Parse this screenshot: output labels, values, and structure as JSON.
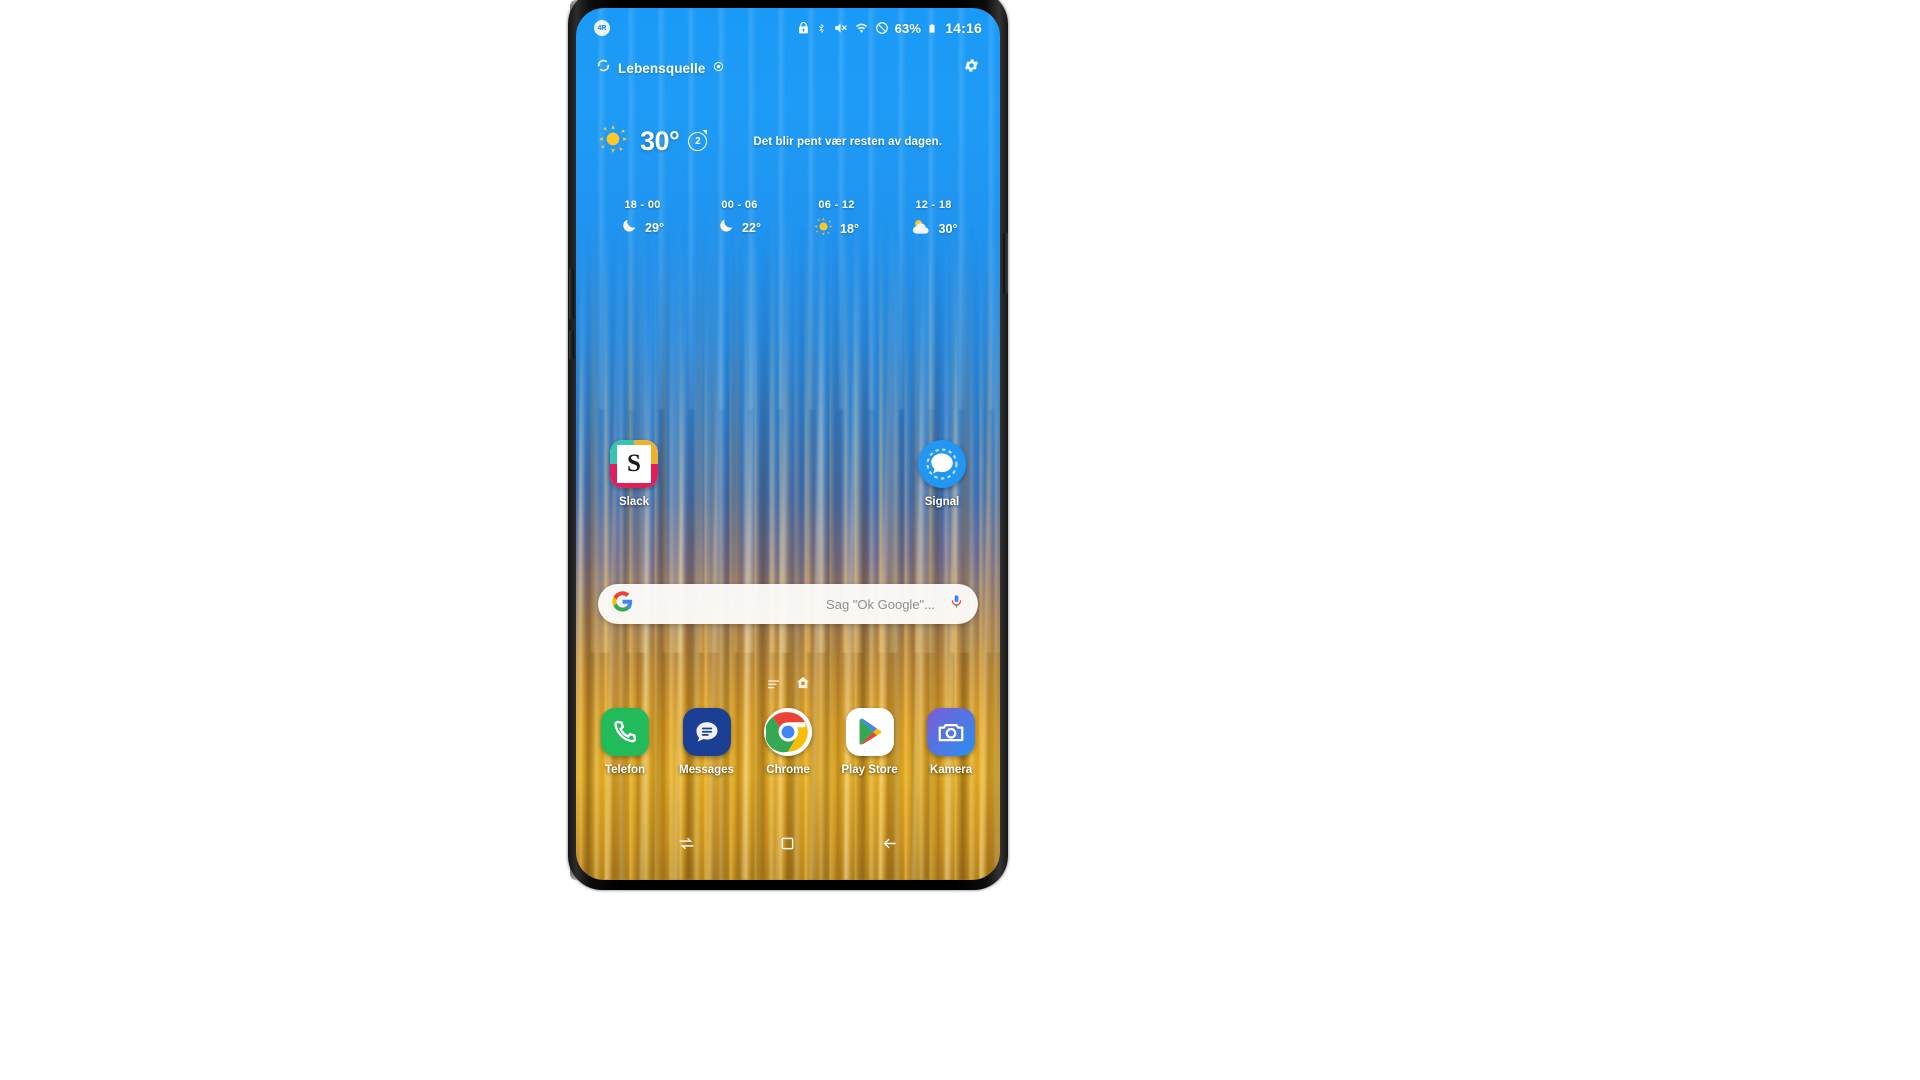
{
  "device": {
    "name": "samsung-galaxy-note-9",
    "screen_label": "home-screen"
  },
  "status_bar": {
    "left_badge": "4R",
    "icons": [
      "secure-lock-icon",
      "bluetooth-icon",
      "volume-mute-icon",
      "wifi-icon",
      "do-not-disturb-icon",
      "battery-icon"
    ],
    "battery_percent": "63%",
    "time": "14:16"
  },
  "weather_widget": {
    "refresh_icon": "refresh-icon",
    "source": "Lebensquelle",
    "location_icon": "location-pin-icon",
    "settings_icon": "gear-icon",
    "condition_icon": "sun-icon",
    "temperature": "30°",
    "refresh_count": "2",
    "description": "Det blir pent vær resten av dagen.",
    "forecast": [
      {
        "range": "18 - 00",
        "icon": "moon-icon",
        "temp": "29°"
      },
      {
        "range": "00 - 06",
        "icon": "moon-icon",
        "temp": "22°"
      },
      {
        "range": "06 - 12",
        "icon": "sun-icon",
        "temp": "18°"
      },
      {
        "range": "12 - 18",
        "icon": "partly-cloudy-icon",
        "temp": "30°"
      }
    ]
  },
  "home_apps": [
    {
      "label": "Slack",
      "icon": "slack-icon"
    },
    {
      "label": "Signal",
      "icon": "signal-icon"
    }
  ],
  "search_bar": {
    "logo_icon": "google-g-icon",
    "placeholder": "Sag \"Ok Google\"...",
    "mic_icon": "microphone-icon"
  },
  "page_indicators": [
    {
      "icon": "pages-lines-icon"
    },
    {
      "icon": "home-page-icon"
    }
  ],
  "dock_apps": [
    {
      "label": "Telefon",
      "icon": "phone-icon"
    },
    {
      "label": "Messages",
      "icon": "messages-icon"
    },
    {
      "label": "Chrome",
      "icon": "chrome-icon"
    },
    {
      "label": "Play Store",
      "icon": "play-store-icon"
    },
    {
      "label": "Kamera",
      "icon": "camera-icon"
    }
  ],
  "nav_bar": [
    {
      "icon": "recents-icon"
    },
    {
      "icon": "home-square-icon"
    },
    {
      "icon": "back-arrow-icon"
    }
  ],
  "colors": {
    "sky": "#1e97f2",
    "gold": "#d79c24",
    "accent_blue": "#2196f3",
    "background": "#ffffff"
  }
}
